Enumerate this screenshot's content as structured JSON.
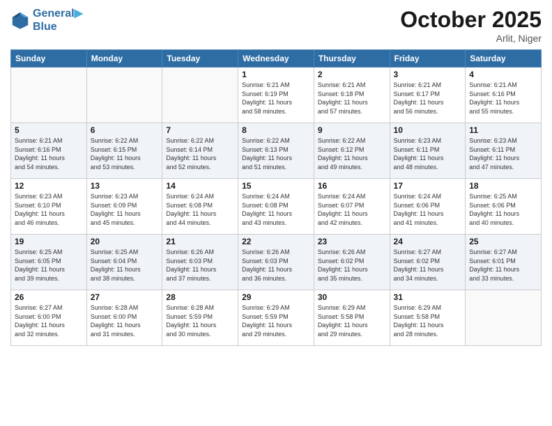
{
  "header": {
    "logo_line1": "General",
    "logo_line2": "Blue",
    "month_title": "October 2025",
    "location": "Arlit, Niger"
  },
  "weekdays": [
    "Sunday",
    "Monday",
    "Tuesday",
    "Wednesday",
    "Thursday",
    "Friday",
    "Saturday"
  ],
  "weeks": [
    [
      {
        "day": "",
        "info": ""
      },
      {
        "day": "",
        "info": ""
      },
      {
        "day": "",
        "info": ""
      },
      {
        "day": "1",
        "info": "Sunrise: 6:21 AM\nSunset: 6:19 PM\nDaylight: 11 hours\nand 58 minutes."
      },
      {
        "day": "2",
        "info": "Sunrise: 6:21 AM\nSunset: 6:18 PM\nDaylight: 11 hours\nand 57 minutes."
      },
      {
        "day": "3",
        "info": "Sunrise: 6:21 AM\nSunset: 6:17 PM\nDaylight: 11 hours\nand 56 minutes."
      },
      {
        "day": "4",
        "info": "Sunrise: 6:21 AM\nSunset: 6:16 PM\nDaylight: 11 hours\nand 55 minutes."
      }
    ],
    [
      {
        "day": "5",
        "info": "Sunrise: 6:21 AM\nSunset: 6:16 PM\nDaylight: 11 hours\nand 54 minutes."
      },
      {
        "day": "6",
        "info": "Sunrise: 6:22 AM\nSunset: 6:15 PM\nDaylight: 11 hours\nand 53 minutes."
      },
      {
        "day": "7",
        "info": "Sunrise: 6:22 AM\nSunset: 6:14 PM\nDaylight: 11 hours\nand 52 minutes."
      },
      {
        "day": "8",
        "info": "Sunrise: 6:22 AM\nSunset: 6:13 PM\nDaylight: 11 hours\nand 51 minutes."
      },
      {
        "day": "9",
        "info": "Sunrise: 6:22 AM\nSunset: 6:12 PM\nDaylight: 11 hours\nand 49 minutes."
      },
      {
        "day": "10",
        "info": "Sunrise: 6:23 AM\nSunset: 6:11 PM\nDaylight: 11 hours\nand 48 minutes."
      },
      {
        "day": "11",
        "info": "Sunrise: 6:23 AM\nSunset: 6:11 PM\nDaylight: 11 hours\nand 47 minutes."
      }
    ],
    [
      {
        "day": "12",
        "info": "Sunrise: 6:23 AM\nSunset: 6:10 PM\nDaylight: 11 hours\nand 46 minutes."
      },
      {
        "day": "13",
        "info": "Sunrise: 6:23 AM\nSunset: 6:09 PM\nDaylight: 11 hours\nand 45 minutes."
      },
      {
        "day": "14",
        "info": "Sunrise: 6:24 AM\nSunset: 6:08 PM\nDaylight: 11 hours\nand 44 minutes."
      },
      {
        "day": "15",
        "info": "Sunrise: 6:24 AM\nSunset: 6:08 PM\nDaylight: 11 hours\nand 43 minutes."
      },
      {
        "day": "16",
        "info": "Sunrise: 6:24 AM\nSunset: 6:07 PM\nDaylight: 11 hours\nand 42 minutes."
      },
      {
        "day": "17",
        "info": "Sunrise: 6:24 AM\nSunset: 6:06 PM\nDaylight: 11 hours\nand 41 minutes."
      },
      {
        "day": "18",
        "info": "Sunrise: 6:25 AM\nSunset: 6:06 PM\nDaylight: 11 hours\nand 40 minutes."
      }
    ],
    [
      {
        "day": "19",
        "info": "Sunrise: 6:25 AM\nSunset: 6:05 PM\nDaylight: 11 hours\nand 39 minutes."
      },
      {
        "day": "20",
        "info": "Sunrise: 6:25 AM\nSunset: 6:04 PM\nDaylight: 11 hours\nand 38 minutes."
      },
      {
        "day": "21",
        "info": "Sunrise: 6:26 AM\nSunset: 6:03 PM\nDaylight: 11 hours\nand 37 minutes."
      },
      {
        "day": "22",
        "info": "Sunrise: 6:26 AM\nSunset: 6:03 PM\nDaylight: 11 hours\nand 36 minutes."
      },
      {
        "day": "23",
        "info": "Sunrise: 6:26 AM\nSunset: 6:02 PM\nDaylight: 11 hours\nand 35 minutes."
      },
      {
        "day": "24",
        "info": "Sunrise: 6:27 AM\nSunset: 6:02 PM\nDaylight: 11 hours\nand 34 minutes."
      },
      {
        "day": "25",
        "info": "Sunrise: 6:27 AM\nSunset: 6:01 PM\nDaylight: 11 hours\nand 33 minutes."
      }
    ],
    [
      {
        "day": "26",
        "info": "Sunrise: 6:27 AM\nSunset: 6:00 PM\nDaylight: 11 hours\nand 32 minutes."
      },
      {
        "day": "27",
        "info": "Sunrise: 6:28 AM\nSunset: 6:00 PM\nDaylight: 11 hours\nand 31 minutes."
      },
      {
        "day": "28",
        "info": "Sunrise: 6:28 AM\nSunset: 5:59 PM\nDaylight: 11 hours\nand 30 minutes."
      },
      {
        "day": "29",
        "info": "Sunrise: 6:29 AM\nSunset: 5:59 PM\nDaylight: 11 hours\nand 29 minutes."
      },
      {
        "day": "30",
        "info": "Sunrise: 6:29 AM\nSunset: 5:58 PM\nDaylight: 11 hours\nand 29 minutes."
      },
      {
        "day": "31",
        "info": "Sunrise: 6:29 AM\nSunset: 5:58 PM\nDaylight: 11 hours\nand 28 minutes."
      },
      {
        "day": "",
        "info": ""
      }
    ]
  ]
}
